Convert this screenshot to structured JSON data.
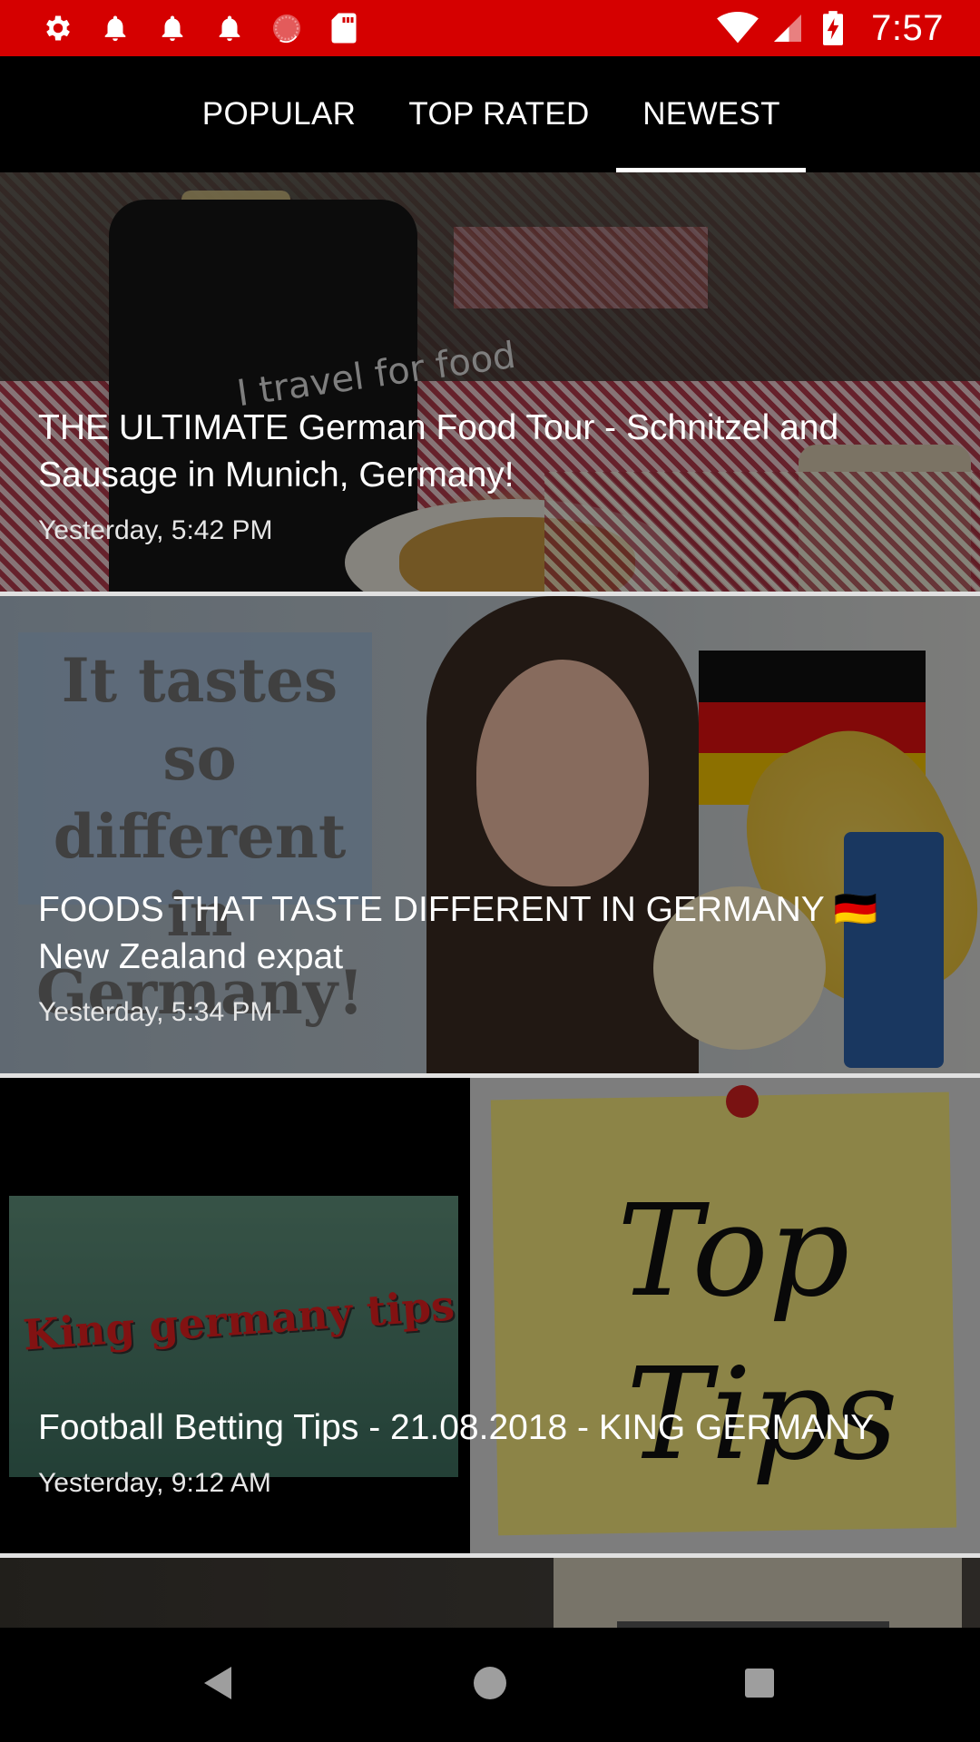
{
  "status_bar": {
    "left_icons": [
      "settings-icon",
      "notification-bell-icon",
      "notification-bell-icon",
      "notification-bell-icon",
      "sync-circle-icon",
      "sd-card-icon"
    ],
    "right_icons": [
      "wifi-icon",
      "cellular-signal-icon",
      "battery-charging-icon"
    ],
    "time": "7:57",
    "color": "#d50000"
  },
  "tabs": {
    "items": [
      {
        "label": "POPULAR",
        "selected": false
      },
      {
        "label": "TOP RATED",
        "selected": false
      },
      {
        "label": "NEWEST",
        "selected": true
      }
    ]
  },
  "feed": {
    "items": [
      {
        "title": "THE ULTIMATE German Food Tour - Schnitzel and Sausage in Munich, Germany!",
        "time": "Yesterday, 5:42 PM",
        "thumbnail": "beer-garden-schnitzel-thumbnail"
      },
      {
        "title": "FOODS THAT TASTE DIFFERENT IN GERMANY 🇩🇪 New Zealand expat",
        "time": "Yesterday, 5:34 PM",
        "thumbnail": "woman-german-flag-thumbnail",
        "thumbnail_text": [
          "It tastes",
          "so different",
          "in Germany!"
        ]
      },
      {
        "title": "Football Betting Tips - 21.08.2018 - KING GERMANY",
        "time": "Yesterday, 9:12 AM",
        "thumbnail": "king-germany-tips-thumbnail",
        "thumbnail_text": [
          "King germany tips",
          "Top",
          "Tips"
        ]
      },
      {
        "title": "",
        "time": "",
        "thumbnail": "partial-next-thumbnail"
      }
    ]
  },
  "nav_bar": {
    "buttons": [
      "back-icon",
      "home-icon",
      "recents-icon"
    ]
  }
}
